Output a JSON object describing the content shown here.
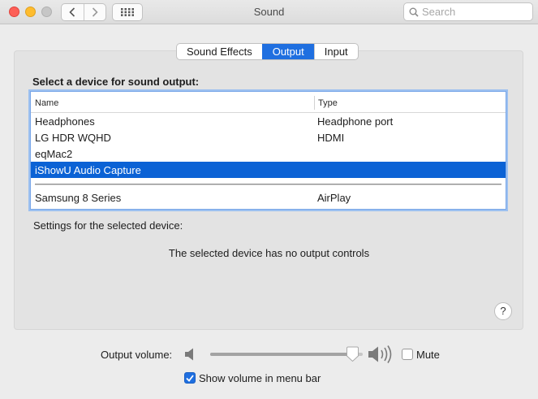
{
  "window": {
    "title": "Sound",
    "search_placeholder": "Search"
  },
  "tabs": [
    {
      "label": "Sound Effects",
      "active": false
    },
    {
      "label": "Output",
      "active": true
    },
    {
      "label": "Input",
      "active": false
    }
  ],
  "output": {
    "prompt": "Select a device for sound output:",
    "columns": [
      "Name",
      "Type"
    ],
    "devices": [
      {
        "name": "Headphones",
        "type": "Headphone port",
        "selected": false
      },
      {
        "name": "LG HDR WQHD",
        "type": "HDMI",
        "selected": false
      },
      {
        "name": "eqMac2",
        "type": "",
        "selected": false
      },
      {
        "name": "iShowU Audio Capture",
        "type": "",
        "selected": true
      },
      {
        "name": "Samsung 8 Series",
        "type": "AirPlay",
        "selected": false
      }
    ],
    "settings_label": "Settings for the selected device:",
    "no_controls_message": "The selected device has no output controls",
    "help_label": "?"
  },
  "volume": {
    "label": "Output volume:",
    "level": 0.93,
    "mute_label": "Mute",
    "muted": false,
    "menu_bar_label": "Show volume in menu bar",
    "show_in_menu_bar": true
  },
  "colors": {
    "accent": "#1f6fe0",
    "selection": "#0b62d5",
    "close": "#fd5f57",
    "minimize": "#febc2e"
  },
  "icons": {
    "back": "chevron-left-icon",
    "forward": "chevron-right-icon",
    "all_prefs": "grid-icon",
    "search": "search-icon",
    "volume_low": "speaker-low-icon",
    "volume_high": "speaker-high-icon"
  }
}
